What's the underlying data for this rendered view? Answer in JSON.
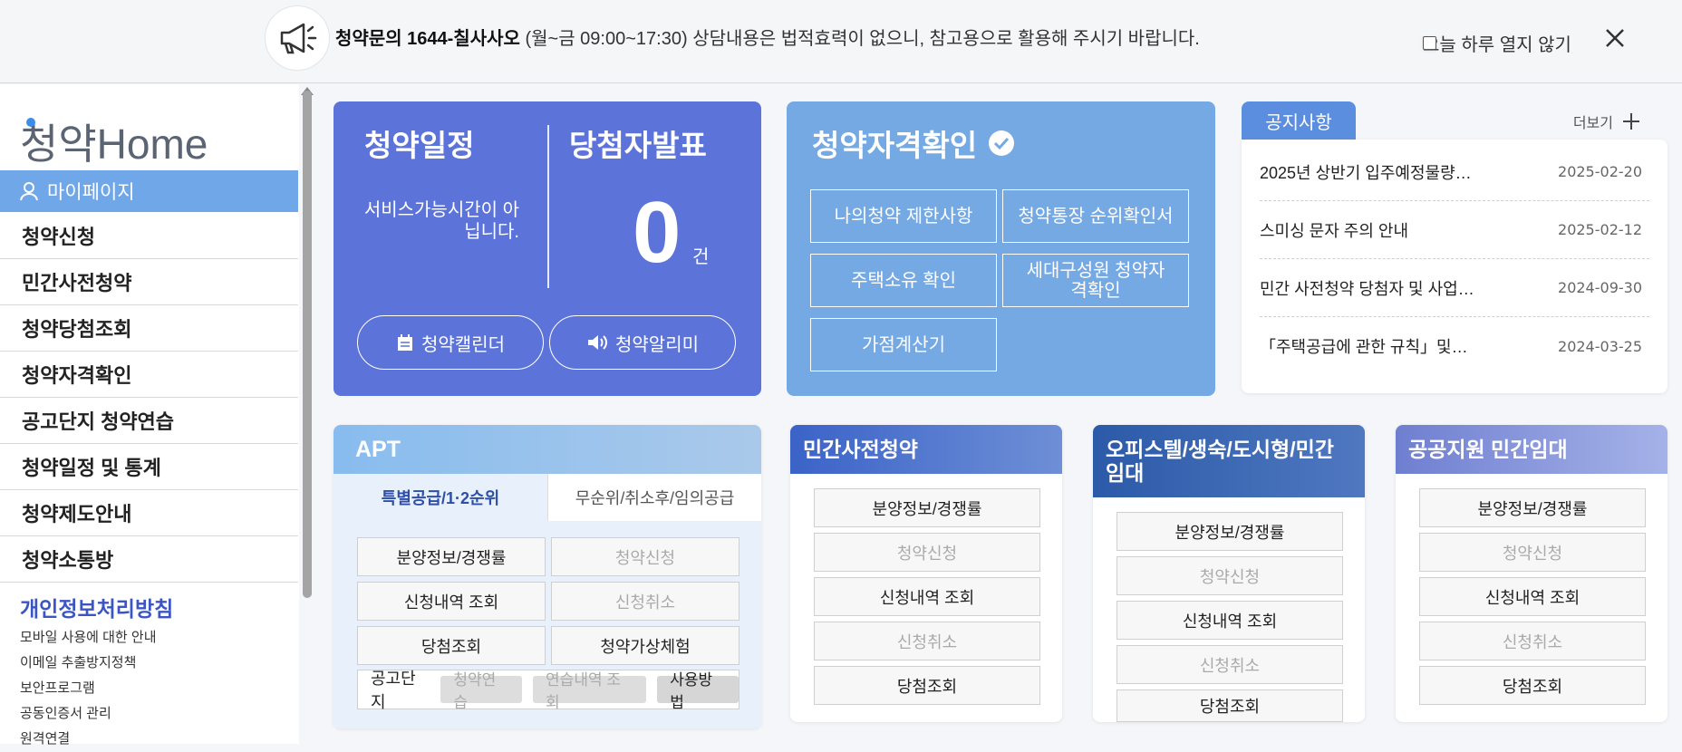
{
  "topbar": {
    "contact": "청약문의 1644-칠사사오",
    "hours": "(월~금 09:00~17:30)",
    "disclaimer": "상담내용은 법적효력이 없으니, 참고용으로 활용해 주시기 바랍니다.",
    "dont_open": "오늘 하루 열지 않기"
  },
  "sidebar": {
    "logo": "청약Home",
    "mypage": "마이페이지",
    "items": [
      "청약신청",
      "민간사전청약",
      "청약당첨조회",
      "청약자격확인",
      "공고단지 청약연습",
      "청약일정 및 통계",
      "청약제도안내",
      "청약소통방"
    ],
    "privacy": "개인정보처리방침",
    "links": [
      "모바일 사용에 대한 안내",
      "이메일 추출방지정책",
      "보안프로그램",
      "공동인증서 관리",
      "원격연결"
    ]
  },
  "schedule": {
    "title": "청약일정",
    "winners_title": "당첨자발표",
    "service_msg": "서비스가능시간이 아닙니다.",
    "count": "0",
    "count_unit": "건",
    "calendar_btn": "청약캘린더",
    "alarm_btn": "청약알리미"
  },
  "qualify": {
    "title": "청약자격확인",
    "buttons": [
      "나의청약 제한사항",
      "청약통장 순위확인서",
      "주택소유 확인",
      "세대구성원 청약자격확인",
      "가점계산기"
    ]
  },
  "notice": {
    "tab": "공지사항",
    "more": "더보기",
    "rows": [
      {
        "title": "2025년 상반기 입주예정물량…",
        "date": "2025-02-20"
      },
      {
        "title": "스미싱 문자 주의 안내",
        "date": "2025-02-12"
      },
      {
        "title": "민간 사전청약 당첨자 및 사업…",
        "date": "2024-09-30"
      },
      {
        "title": "「주택공급에 관한 규칙」및…",
        "date": "2024-03-25"
      }
    ]
  },
  "apt": {
    "title": "APT",
    "tab_active": "특별공급/1·2순위",
    "tab_other": "무순위/취소후/임의공급",
    "buttons": [
      "분양정보/경쟁률",
      "청약신청",
      "신청내역 조회",
      "신청취소",
      "당첨조회",
      "청약가상체험"
    ],
    "bar_label": "공고단지",
    "chips": [
      "청약연습",
      "연습내역 조회",
      "사용방법"
    ]
  },
  "private": {
    "title": "민간사전청약",
    "buttons": [
      "분양정보/경쟁률",
      "청약신청",
      "신청내역 조회",
      "신청취소",
      "당첨조회"
    ]
  },
  "officetel": {
    "title": "오피스텔/생숙/도시형/민간임대",
    "buttons": [
      "분양정보/경쟁률",
      "청약신청",
      "신청내역 조회",
      "신청취소",
      "당첨조회"
    ]
  },
  "public": {
    "title": "공공지원 민간임대",
    "buttons": [
      "분양정보/경쟁률",
      "청약신청",
      "신청내역 조회",
      "신청취소",
      "당첨조회"
    ]
  },
  "colors": {
    "schedule": "#5c73d9",
    "qualify": "#75a9e3",
    "notice_tab": "#5c8ee0",
    "privacy": "#3b56c4"
  }
}
